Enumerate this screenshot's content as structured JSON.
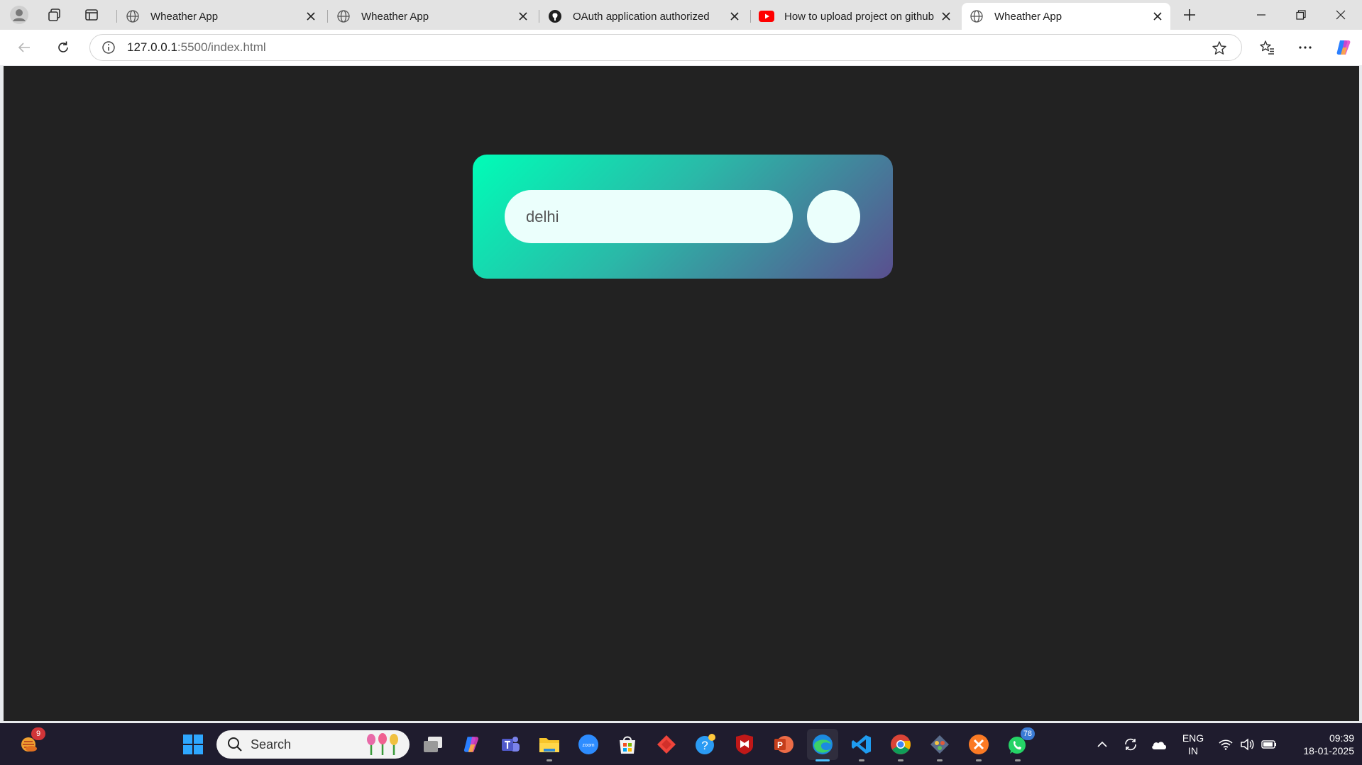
{
  "browser": {
    "tabs": [
      {
        "title": "Wheather App",
        "favicon": "globe-icon",
        "active": false
      },
      {
        "title": "Wheather App",
        "favicon": "globe-icon",
        "active": false
      },
      {
        "title": "OAuth application authorized",
        "favicon": "github-icon",
        "active": false
      },
      {
        "title": "How to upload project on github",
        "favicon": "youtube-icon",
        "active": false
      },
      {
        "title": "Wheather App",
        "favicon": "globe-icon",
        "active": true
      }
    ],
    "address": {
      "host": "127.0.0.1",
      "rest": ":5500/index.html"
    }
  },
  "page": {
    "search_value": "delhi",
    "card_gradient": [
      "#00fdb7",
      "#5a4f8f"
    ],
    "background": "#222222"
  },
  "taskbar": {
    "search_label": "Search",
    "weather_badge": "9",
    "whatsapp_badge": "78",
    "lang_top": "ENG",
    "lang_bottom": "IN",
    "time": "09:39",
    "date": "18-01-2025"
  }
}
